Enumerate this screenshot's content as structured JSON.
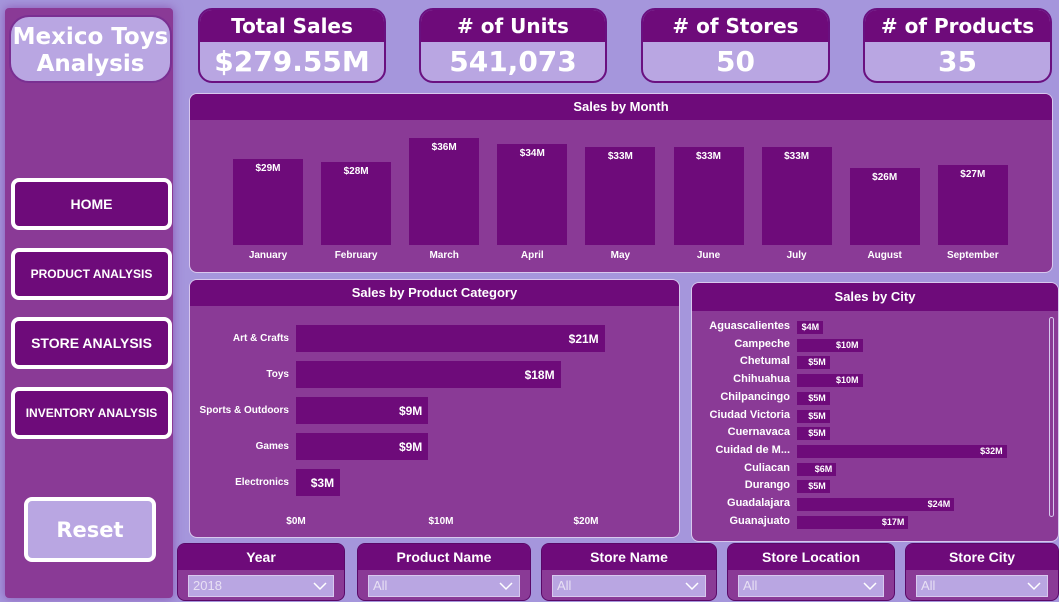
{
  "app": {
    "title_line1": "Mexico Toys",
    "title_line2": "Analysis"
  },
  "nav": [
    {
      "label": "HOME"
    },
    {
      "label": "PRODUCT ANALYSIS"
    },
    {
      "label": "STORE ANALYSIS"
    },
    {
      "label": "INVENTORY ANALYSIS"
    }
  ],
  "reset_label": "Reset",
  "kpis": [
    {
      "label": "Total Sales",
      "value": "$279.55M"
    },
    {
      "label": "# of Units",
      "value": "541,073"
    },
    {
      "label": "# of Stores",
      "value": "50"
    },
    {
      "label": "# of Products",
      "value": "35"
    }
  ],
  "filters": [
    {
      "label": "Year",
      "value": "2018"
    },
    {
      "label": "Product Name",
      "value": "All"
    },
    {
      "label": "Store Name",
      "value": "All"
    },
    {
      "label": "Store Location",
      "value": "All"
    },
    {
      "label": "Store City",
      "value": "All"
    }
  ],
  "colors": {
    "background": "#a596dc",
    "panel": "#8a3a96",
    "bar": "#6e0b7a",
    "accent_light": "#b9a6e2"
  },
  "chart_data": [
    {
      "type": "bar",
      "title": "Sales by Month",
      "categories": [
        "January",
        "February",
        "March",
        "April",
        "May",
        "June",
        "July",
        "August",
        "September"
      ],
      "values": [
        29,
        28,
        36,
        34,
        33,
        33,
        33,
        26,
        27
      ],
      "data_labels": [
        "$29M",
        "$28M",
        "$36M",
        "$34M",
        "$33M",
        "$33M",
        "$33M",
        "$26M",
        "$27M"
      ],
      "units": "$M",
      "ylim": [
        0,
        40
      ]
    },
    {
      "type": "bar",
      "orientation": "horizontal",
      "title": "Sales by Product Category",
      "categories": [
        "Art & Crafts",
        "Toys",
        "Sports & Outdoors",
        "Games",
        "Electronics"
      ],
      "values": [
        21,
        18,
        9,
        9,
        3
      ],
      "data_labels": [
        "$21M",
        "$18M",
        "$9M",
        "$9M",
        "$3M"
      ],
      "xticks": [
        "$0M",
        "$10M",
        "$20M"
      ],
      "xlim": [
        0,
        22
      ]
    },
    {
      "type": "bar",
      "orientation": "horizontal",
      "title": "Sales by City",
      "categories": [
        "Aguascalientes",
        "Campeche",
        "Chetumal",
        "Chihuahua",
        "Chilpancingo",
        "Ciudad Victoria",
        "Cuernavaca",
        "Cuidad de M...",
        "Culiacan",
        "Durango",
        "Guadalajara",
        "Guanajuato"
      ],
      "values": [
        4,
        10,
        5,
        10,
        5,
        5,
        5,
        32,
        6,
        5,
        24,
        17
      ],
      "data_labels": [
        "$4M",
        "$10M",
        "$5M",
        "$10M",
        "$5M",
        "$5M",
        "$5M",
        "$32M",
        "$6M",
        "$5M",
        "$24M",
        "$17M"
      ],
      "xlim": [
        0,
        34
      ]
    }
  ]
}
